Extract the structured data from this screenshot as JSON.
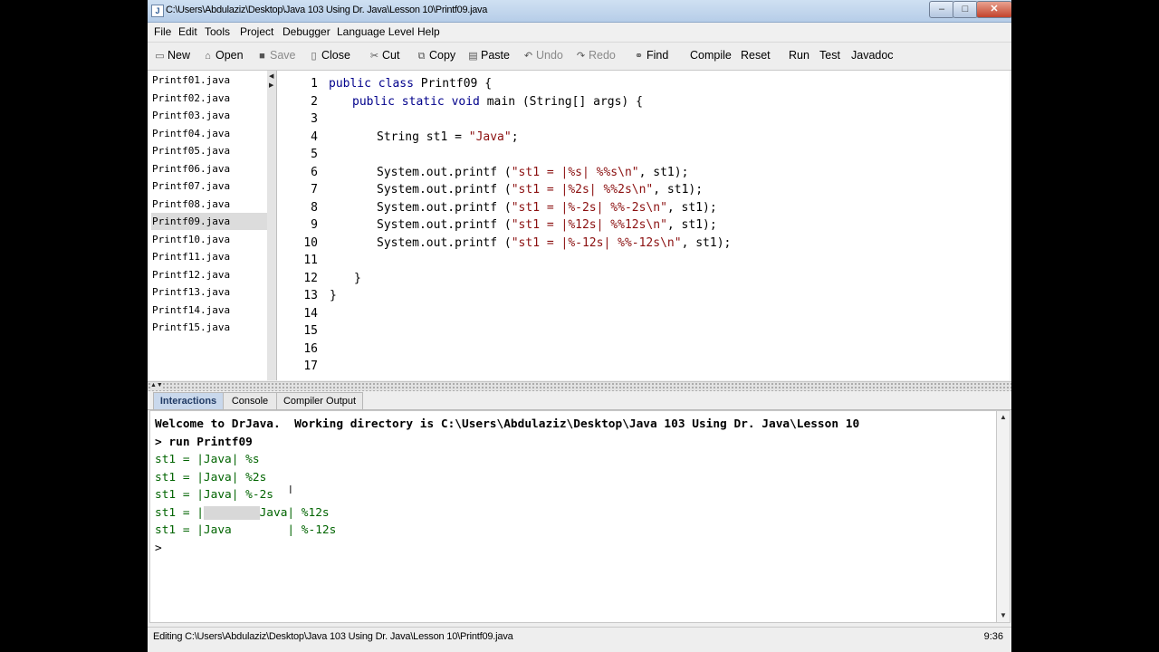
{
  "window": {
    "title": "C:\\Users\\Abdulaziz\\Desktop\\Java 103 Using Dr. Java\\Lesson 10\\Printf09.java",
    "controls": {
      "minimize": "–",
      "maximize": "□",
      "close": "✕"
    }
  },
  "menu": [
    "File",
    "Edit",
    "Tools",
    "Project",
    "Debugger",
    "Language Level",
    "Help"
  ],
  "toolbar": {
    "new": "New",
    "open": "Open",
    "save": "Save",
    "close": "Close",
    "cut": "Cut",
    "copy": "Copy",
    "paste": "Paste",
    "undo": "Undo",
    "redo": "Redo",
    "find": "Find",
    "compile": "Compile",
    "reset": "Reset",
    "run": "Run",
    "test": "Test",
    "javadoc": "Javadoc"
  },
  "files": [
    "Printf01.java",
    "Printf02.java",
    "Printf03.java",
    "Printf04.java",
    "Printf05.java",
    "Printf06.java",
    "Printf07.java",
    "Printf08.java",
    "Printf09.java",
    "Printf10.java",
    "Printf11.java",
    "Printf12.java",
    "Printf13.java",
    "Printf14.java",
    "Printf15.java"
  ],
  "selected_file": "Printf09.java",
  "editor": {
    "line_numbers": [
      "1",
      "2",
      "3",
      "4",
      "5",
      "6",
      "7",
      "8",
      "9",
      "10",
      "11",
      "12",
      "13",
      "14",
      "15",
      "16",
      "17"
    ],
    "code": {
      "l1_kw": "public class",
      "l1_rest": " Printf09 {",
      "l2_kw": "public static void",
      "l2_rest": " main (String[] args) {",
      "l4_pre": "String st1 = ",
      "l4_str": "\"Java\"",
      "l4_post": ";",
      "l6_pre": "System.out.printf (",
      "l6_str": "\"st1 = |%s| %%s\\n\"",
      "l6_post": ", st1);",
      "l7_pre": "System.out.printf (",
      "l7_str": "\"st1 = |%2s| %%2s\\n\"",
      "l7_post": ", st1);",
      "l8_pre": "System.out.printf (",
      "l8_str": "\"st1 = |%-2s| %%-2s\\n\"",
      "l8_post": ", st1);",
      "l9_pre": "System.out.printf (",
      "l9_str": "\"st1 = |%12s| %%12s\\n\"",
      "l9_post": ", st1);",
      "l10_pre": "System.out.printf (",
      "l10_str": "\"st1 = |%-12s| %%-12s\\n\"",
      "l10_post": ", st1);",
      "l12": "}",
      "l13": "}"
    }
  },
  "tabs": [
    "Interactions",
    "Console",
    "Compiler Output"
  ],
  "active_tab": "Interactions",
  "interactions": {
    "welcome": "Welcome to DrJava.  Working directory is C:\\Users\\Abdulaziz\\Desktop\\Java 103 Using Dr. Java\\Lesson 10",
    "command": "> run Printf09",
    "out1": "st1 = |Java| %s",
    "out2": "st1 = |Java| %2s",
    "out3": "st1 = |Java| %-2s",
    "out4_a": "st1 = |",
    "out4_hl": "        ",
    "out4_b": "Java| %12s",
    "out5": "st1 = |Java        | %-12s",
    "prompt": ">"
  },
  "status": {
    "editing": "Editing C:\\Users\\Abdulaziz\\Desktop\\Java 103 Using Dr. Java\\Lesson 10\\Printf09.java",
    "position": "9:36"
  }
}
